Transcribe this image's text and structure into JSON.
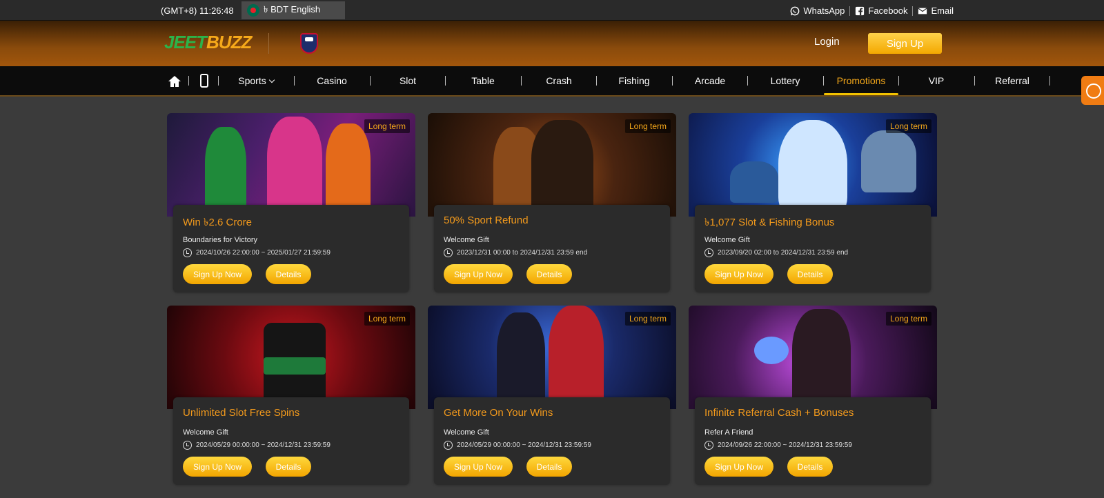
{
  "topbar": {
    "time": "(GMT+8) 11:26:48",
    "language": "৳ BDT English",
    "contacts": [
      {
        "label": "WhatsApp",
        "icon": "whatsapp-icon"
      },
      {
        "label": "Facebook",
        "icon": "facebook-icon"
      },
      {
        "label": "Email",
        "icon": "email-icon"
      }
    ]
  },
  "header": {
    "logo_part1": "JEET",
    "logo_part2": "BUZZ",
    "login_label": "Login",
    "signup_label": "Sign Up"
  },
  "nav": {
    "items": [
      {
        "label": "Sports"
      },
      {
        "label": "Casino"
      },
      {
        "label": "Slot"
      },
      {
        "label": "Table"
      },
      {
        "label": "Crash"
      },
      {
        "label": "Fishing"
      },
      {
        "label": "Arcade"
      },
      {
        "label": "Lottery"
      },
      {
        "label": "Promotions"
      },
      {
        "label": "VIP"
      },
      {
        "label": "Referral"
      }
    ],
    "active": "Promotions"
  },
  "promotions": [
    {
      "badge": "Long term",
      "title": "Win ৳2.6 Crore",
      "subtitle": "Boundaries for Victory",
      "date": "2024/10/26 22:00:00 ~ 2025/01/27 21:59:59",
      "signup_label": "Sign Up Now",
      "details_label": "Details"
    },
    {
      "badge": "Long term",
      "title": "50% Sport Refund",
      "subtitle": "Welcome Gift",
      "date": "2023/12/31 00:00  to   2024/12/31 23:59  end",
      "signup_label": "Sign Up Now",
      "details_label": "Details"
    },
    {
      "badge": "Long term",
      "title": "৳1,077 Slot & Fishing Bonus",
      "subtitle": "Welcome Gift",
      "date": "2023/09/20 02:00  to   2024/12/31 23:59  end",
      "signup_label": "Sign Up Now",
      "details_label": "Details"
    },
    {
      "badge": "Long term",
      "title": "Unlimited Slot Free Spins",
      "subtitle": "Welcome Gift",
      "date": "2024/05/29 00:00:00 ~ 2024/12/31 23:59:59",
      "signup_label": "Sign Up Now",
      "details_label": "Details"
    },
    {
      "badge": "Long term",
      "title": "Get More On Your Wins",
      "subtitle": "Welcome Gift",
      "date": "2024/05/29 00:00:00 ~ 2024/12/31 23:59:59",
      "signup_label": "Sign Up Now",
      "details_label": "Details"
    },
    {
      "badge": "Long term",
      "title": "Infinite Referral Cash + Bonuses",
      "subtitle": "Refer A Friend",
      "date": "2024/09/26 22:00:00 ~ 2024/12/31 23:59:59",
      "signup_label": "Sign Up Now",
      "details_label": "Details"
    }
  ],
  "colors": {
    "accent": "#f39a1c",
    "button_yellow": "#f3b400",
    "background": "#3b3b3b"
  }
}
